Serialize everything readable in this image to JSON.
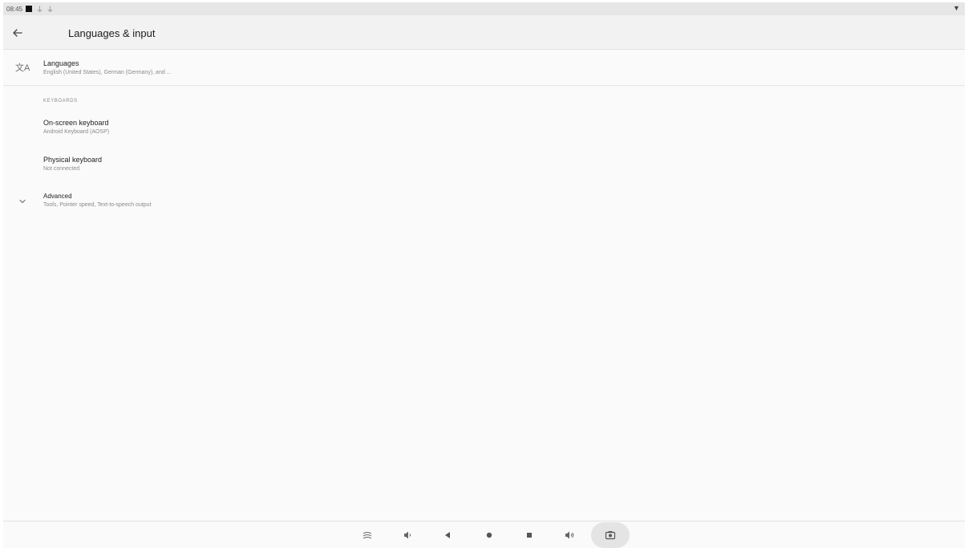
{
  "status_bar": {
    "time": "08:45",
    "icons": [
      "notification-square-icon",
      "usb-icon",
      "usb-icon",
      "wifi-icon"
    ]
  },
  "app_bar": {
    "title": "Languages & input",
    "back_icon": "arrow-back-icon"
  },
  "languages": {
    "icon": "translate-icon",
    "title": "Languages",
    "summary": "English (United States), German (Germany), and ..."
  },
  "keyboards": {
    "category": "KEYBOARDS",
    "items": [
      {
        "title": "On-screen keyboard",
        "summary": "Android Keyboard (AOSP)"
      },
      {
        "title": "Physical keyboard",
        "summary": "Not connected"
      }
    ]
  },
  "advanced": {
    "icon": "chevron-down-icon",
    "title": "Advanced",
    "summary": "Tools, Pointer speed, Text-to-speech output"
  },
  "nav_bar": {
    "buttons": [
      "collapse-icon",
      "volume-down-icon",
      "back-icon",
      "home-icon",
      "recents-icon",
      "volume-up-icon",
      "screenshot-icon"
    ]
  },
  "colors": {
    "background": "#fafafa",
    "app_bar": "#f2f2f2",
    "status_bar": "#e6e6e6",
    "primary_text": "#222222",
    "secondary_text": "#8a8a8a"
  }
}
